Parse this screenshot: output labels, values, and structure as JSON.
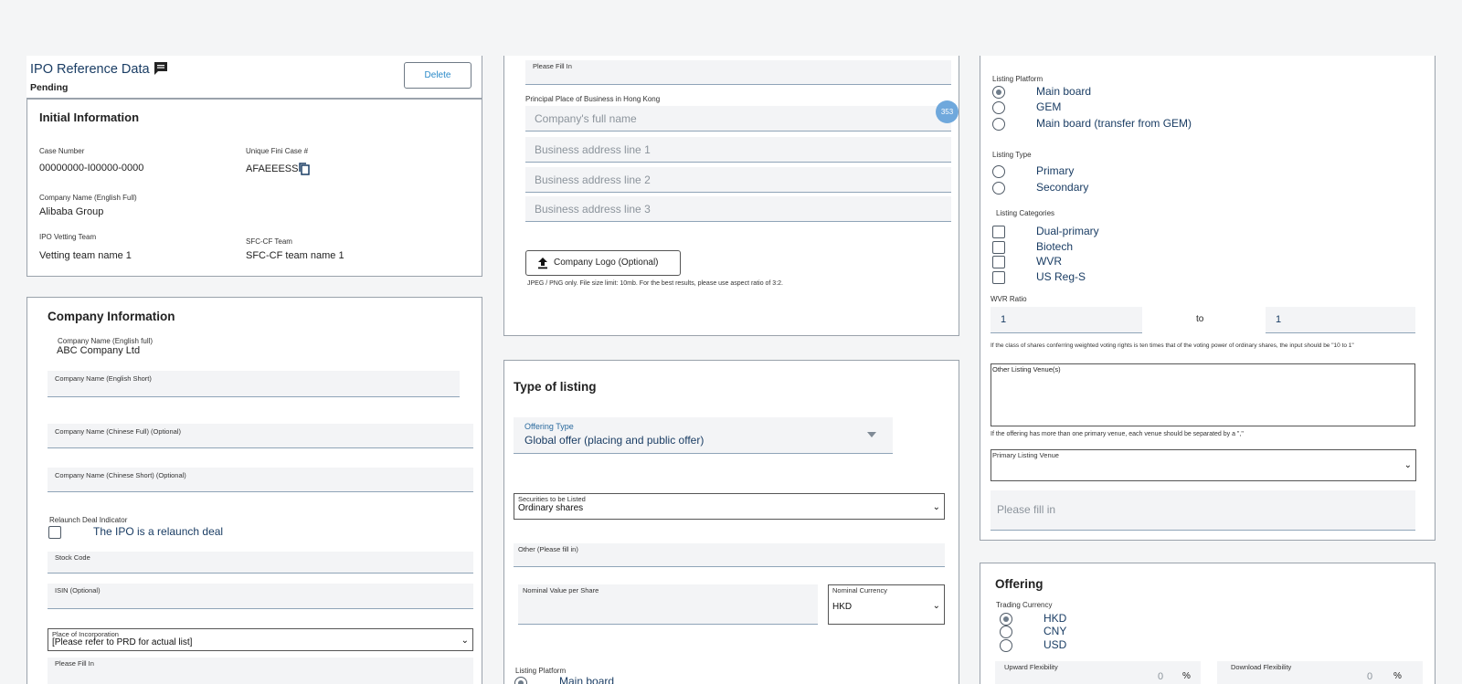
{
  "header": {
    "title": "IPO Reference Data",
    "status": "Pending",
    "delete_label": "Delete"
  },
  "initial_info": {
    "heading": "Initial Information",
    "case_number_label": "Case Number",
    "case_number": "00000000-I00000-0000",
    "fini_label": "Unique Fini Case #",
    "fini_value": "AFAEEESS",
    "company_name_label": "Company  Name (English Full)",
    "company_name": "Alibaba Group",
    "vetting_label": "IPO Vetting Team",
    "vetting_value": "Vetting team name 1",
    "sfc_label": "SFC-CF Team",
    "sfc_value": "SFC-CF team name 1"
  },
  "company_info": {
    "heading": "Company Information",
    "name_full_label": "Company Name (English full)",
    "name_full": "ABC Company Ltd",
    "name_short_label": "Company Name (English Short)",
    "chinese_full_label": "Company Name (Chinese Full) (Optional)",
    "chinese_short_label": "Company Name (Chinese Short) (Optional)",
    "relaunch_label": "Relaunch Deal Indicator",
    "relaunch_option": "The IPO is a relaunch deal",
    "stock_code_label": "Stock Code",
    "isin_label": "ISIN (Optional)",
    "incorporation_label": "Place of Incorporation",
    "incorporation_value": "[Please refer to PRD for actual list]",
    "please_fill_label": "Please Fill In"
  },
  "business": {
    "please_fill_label": "Please Fill In",
    "principal_label": "Principal Place of Business in Hong Kong",
    "company_full_name_ph": "Company's full name",
    "address1_ph": "Business address line 1",
    "address2_ph": "Business address line 2",
    "address3_ph": "Business address line 3",
    "badge": "353",
    "logo_button": "Company Logo (Optional)",
    "logo_note": "JPEG / PNG only. File size limit: 10mb. For the best results, please use aspect ratio of 3:2."
  },
  "type_of_listing": {
    "heading": "Type of listing",
    "offering_type_label": "Offering Type",
    "offering_type_value": "Global offer (placing and public offer)",
    "securities_label": "Securities to be Listed",
    "securities_value": "Ordinary shares",
    "other_label": "Other (Please fill in)",
    "nominal_value_label": "Nominal Value per Share",
    "nominal_currency_label": "Nominal Currency",
    "nominal_currency_value": "HKD",
    "listing_platform_label": "Listing Platform",
    "main_board": "Main board"
  },
  "listing": {
    "platform_label": "Listing Platform",
    "platform_options": [
      "Main board",
      "GEM",
      "Main board (transfer from GEM)"
    ],
    "type_label": "Listing Type",
    "type_options": [
      "Primary",
      "Secondary"
    ],
    "categories_label": "Listing Categories",
    "category_options": [
      "Dual-primary",
      "Biotech",
      "WVR",
      "US Reg-S"
    ],
    "wvr_label": "WVR Ratio",
    "wvr_left": "1",
    "wvr_to": "to",
    "wvr_right": "1",
    "wvr_note": "If the class of shares conferring weighted voting rights is ten times that of the voting power of ordinary shares, the input should be \"10 to 1\"",
    "other_venue_label": "Other Listing Venue(s)",
    "other_venue_note": "If the offering has more than one primary venue, each venue should be separated by a \",\"",
    "primary_venue_label": "Primary Listing Venue",
    "please_fill_ph": "Please fill in"
  },
  "offering": {
    "heading": "Offering",
    "currency_label": "Trading Currency",
    "currency_options": [
      "HKD",
      "CNY",
      "USD"
    ],
    "upward_label": "Upward Flexibility",
    "upward_value": "0",
    "download_label": "Download Flexibility",
    "download_value": "0",
    "percent": "%"
  },
  "colors": {
    "accent_blue": "#1a3d64",
    "link_blue": "#2a8ac8",
    "badge_blue": "#6fa8dc"
  }
}
